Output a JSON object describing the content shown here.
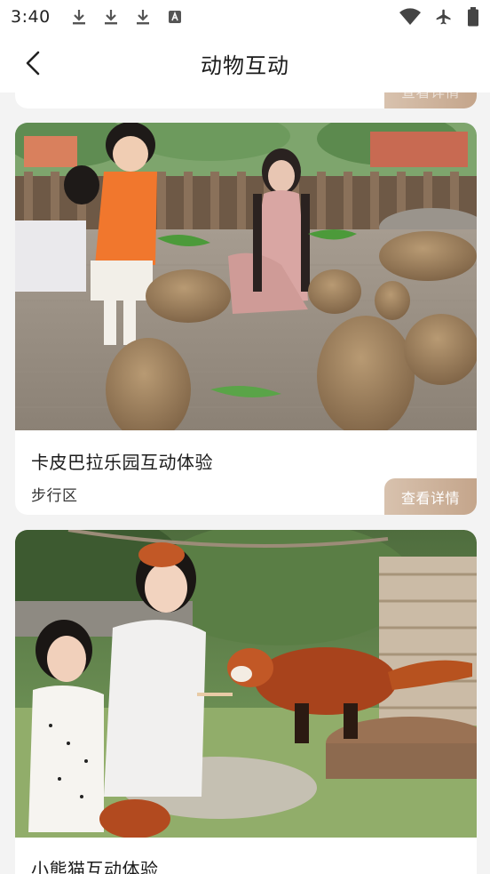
{
  "status_bar": {
    "time": "3:40",
    "left_icons": [
      "download-icon",
      "download-icon",
      "download-icon",
      "font-a-icon"
    ],
    "right_icons": [
      "wifi-icon",
      "airplane-icon",
      "battery-icon"
    ]
  },
  "header": {
    "title": "动物互动",
    "back_icon": "chevron-left-icon"
  },
  "cards": [
    {
      "title": "",
      "location": "",
      "button": "查看详情"
    },
    {
      "title": "卡皮巴拉乐园互动体验",
      "location": "步行区",
      "button": "查看详情",
      "image": "capybara-feeding-photo"
    },
    {
      "title": "小熊猫互动体验",
      "location": "",
      "button": "",
      "image": "red-panda-feeding-photo"
    }
  ],
  "colors": {
    "button_gradient_start": "#d8c2ae",
    "button_gradient_end": "#c4a58b",
    "background": "#f3f3f3"
  }
}
